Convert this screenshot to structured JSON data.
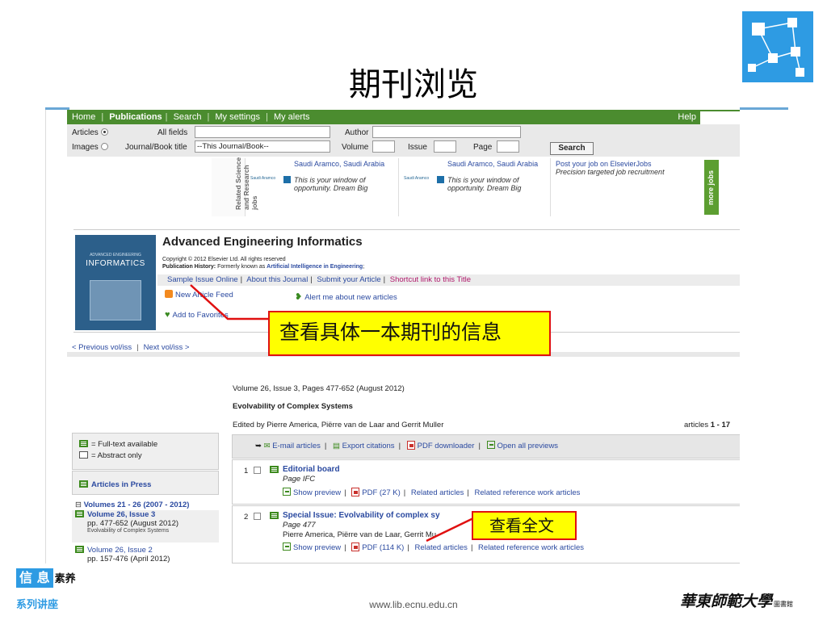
{
  "slide": {
    "title": "期刊浏览",
    "footer_url": "www.lib.ecnu.edu.cn",
    "badge_left": "信 息",
    "badge_right": "素养",
    "series_label": "系列讲座",
    "university": "華東師範大學",
    "university_sub": "圖書館"
  },
  "nav": {
    "items": [
      "Home",
      "Publications",
      "Search",
      "My settings",
      "My alerts"
    ],
    "help": "Help"
  },
  "search": {
    "articles_label": "Articles",
    "images_label": "Images",
    "all_fields_label": "All fields",
    "journal_label": "Journal/Book title",
    "journal_value": "--This Journal/Book--",
    "author_label": "Author",
    "volume_label": "Volume",
    "issue_label": "Issue",
    "page_label": "Page",
    "search_button": "Search",
    "selected": "Articles"
  },
  "jobs": {
    "section_label": "Related Science and Research jobs",
    "items": [
      {
        "logo": "Saudi Aramco",
        "title": "Saudi Aramco, Saudi Arabia",
        "desc": "This is your window of opportunity. Dream Big"
      },
      {
        "logo": "Saudi Aramco",
        "title": "Saudi Aramco, Saudi Arabia",
        "desc": "This is your window of opportunity. Dream Big"
      },
      {
        "title": "Post your job on ElsevierJobs",
        "desc": "Precision targeted job recruitment"
      }
    ],
    "more_label": "more jobs"
  },
  "journal": {
    "cover_small": "ADVANCED ENGINEERING",
    "cover_title": "INFORMATICS",
    "title": "Advanced Engineering Informatics",
    "copyright": "Copyright © 2012 Elsevier Ltd. All rights reserved",
    "history_label": "Publication History:",
    "history_text": "Formerly known as",
    "history_link": "Artificial Intelligence in Engineering",
    "links": [
      "Sample Issue Online",
      "About this Journal",
      "Submit your Article",
      "Shortcut link to this Title"
    ],
    "feed": "New Article Feed",
    "alert": "Alert me about new articles",
    "favorites": "Add to Favorites"
  },
  "pager": {
    "prev": "< Previous vol/iss",
    "next": "Next vol/iss >"
  },
  "issue": {
    "volume_info": "Volume 26, Issue 3, Pages 477-652 (August 2012)",
    "title": "Evolvability of Complex Systems",
    "editors": "Edited by Pierre America, Piërre van de Laar and Gerrit Muller",
    "count_label": "articles",
    "count_range": "1 - 17"
  },
  "legend": {
    "full_text": "= Full-text available",
    "abstract": "= Abstract only"
  },
  "sidebar": {
    "articles_in_press": "Articles in Press",
    "volumes_range": "Volumes 21 - 26 (2007 - 2012)",
    "volumes": [
      {
        "name": "Volume 26, Issue 3",
        "pages": "pp. 477-652 (August 2012)",
        "subtitle": "Evolvability of Complex Systems"
      },
      {
        "name": "Volume 26, Issue 2",
        "pages": "pp. 157-476 (April 2012)"
      }
    ]
  },
  "toolbar": {
    "email": "E-mail articles",
    "export": "Export citations",
    "pdf_downloader": "PDF downloader",
    "open_previews": "Open all previews"
  },
  "articles": [
    {
      "num": "1",
      "title": "Editorial board",
      "page": "Page IFC",
      "authors": "",
      "preview": "Show preview",
      "pdf": "PDF (27 K)",
      "related": "Related articles",
      "reference": "Related reference work articles"
    },
    {
      "num": "2",
      "title": "Special Issue: Evolvability of complex sy",
      "page": "Page 477",
      "authors": "Pierre America, Piërre van de Laar, Gerrit Mu",
      "preview": "Show preview",
      "pdf": "PDF (114 K)",
      "related": "Related articles",
      "reference": "Related reference work articles"
    }
  ],
  "callouts": {
    "journal_info": "查看具体一本期刊的信息",
    "full_text": "查看全文"
  },
  "colors": {
    "nav_green": "#4b8c2f",
    "link_blue": "#2b4aa0",
    "callout_yellow": "#ffff00",
    "callout_border": "#e01010",
    "brand_blue": "#2e9be3"
  }
}
